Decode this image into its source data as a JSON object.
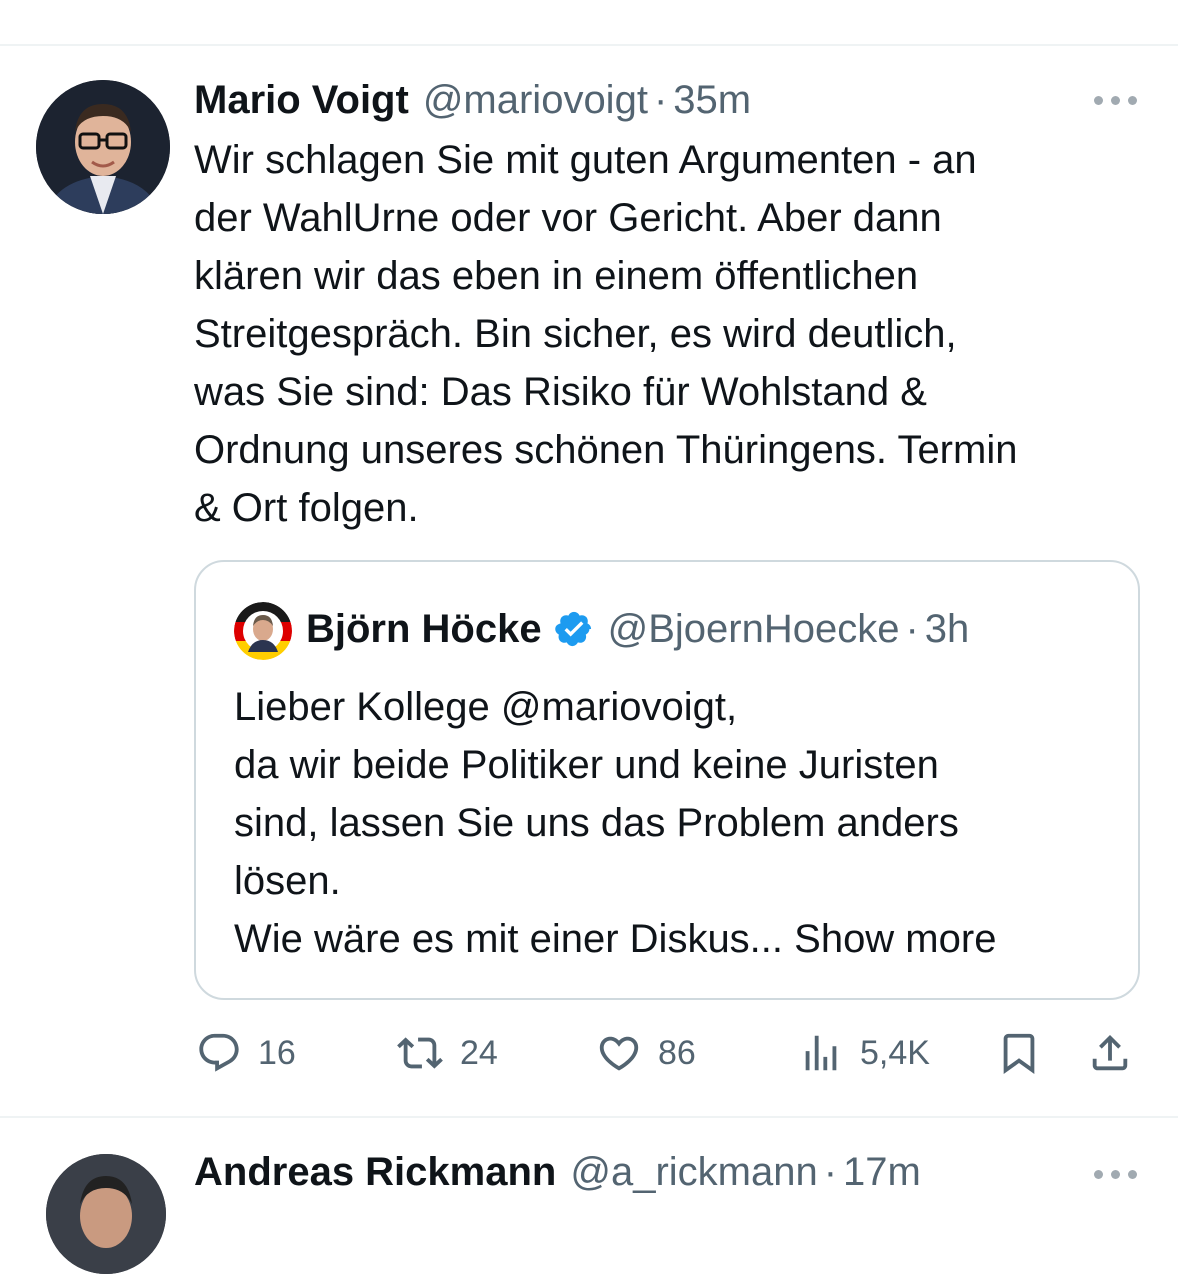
{
  "tweet": {
    "author_name": "Mario Voigt",
    "author_handle": "@mariovoigt",
    "separator": "·",
    "time": "35m",
    "text_lines": [
      "Wir schlagen Sie mit guten Argumenten - an",
      "der WahlUrne oder vor Gericht. Aber dann",
      "klären wir das eben in einem öffentlichen",
      "Streitgespräch. Bin sicher, es wird deutlich,",
      "was Sie sind: Das Risiko für Wohlstand &",
      "Ordnung unseres schönen Thüringens. Termin",
      "& Ort folgen."
    ],
    "quoted": {
      "author_name": "Björn Höcke",
      "verified": true,
      "author_handle": "@BjoernHoecke",
      "separator": "·",
      "time": "3h",
      "text_lines": [
        "Lieber Kollege @mariovoigt,",
        "da wir beide Politiker und keine Juristen",
        "sind, lassen Sie uns das Problem anders",
        "lösen.",
        "Wie wäre es mit einer Diskus... Show more"
      ]
    },
    "actions": {
      "replies": "16",
      "reposts": "24",
      "likes": "86",
      "views": "5,4K"
    }
  },
  "next_tweet": {
    "author_name": "Andreas Rickmann",
    "author_handle": "@a_rickmann",
    "separator": "·",
    "time": "17m"
  },
  "colors": {
    "text": "#0f1419",
    "secondary": "#536471",
    "border": "#cfd9de",
    "verified": "#1d9bf0"
  },
  "icons": [
    "more-icon",
    "verified-badge-icon",
    "reply-icon",
    "repost-icon",
    "like-icon",
    "views-icon",
    "bookmark-icon",
    "share-icon"
  ]
}
